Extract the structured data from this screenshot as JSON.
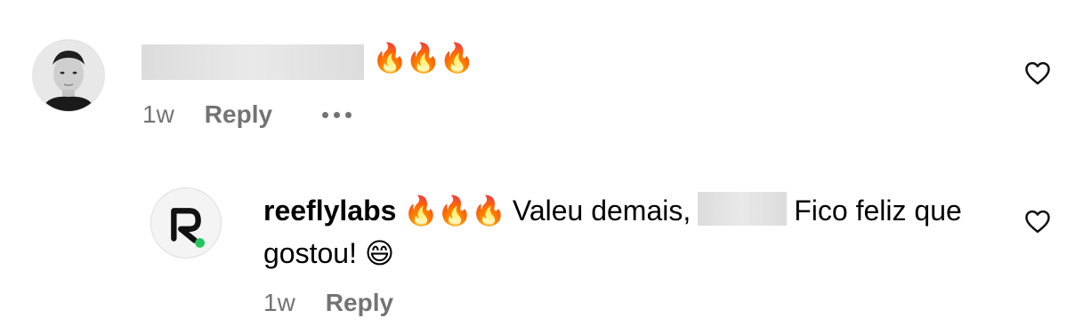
{
  "comment": {
    "emoji": "🔥🔥🔥",
    "time": "1w",
    "reply_label": "Reply",
    "more_icon": "more-horizontal-icon",
    "like_icon": "heart-outline-icon"
  },
  "reply": {
    "username": "reeflylabs",
    "emoji": "🔥🔥🔥",
    "text_before": "Valeu demais,",
    "text_after": "Fico feliz que gostou!",
    "smiley": "😄",
    "time": "1w",
    "reply_label": "Reply",
    "like_icon": "heart-outline-icon"
  },
  "colors": {
    "meta_gray": "#737373",
    "avatar_dot": "#22c55e"
  }
}
